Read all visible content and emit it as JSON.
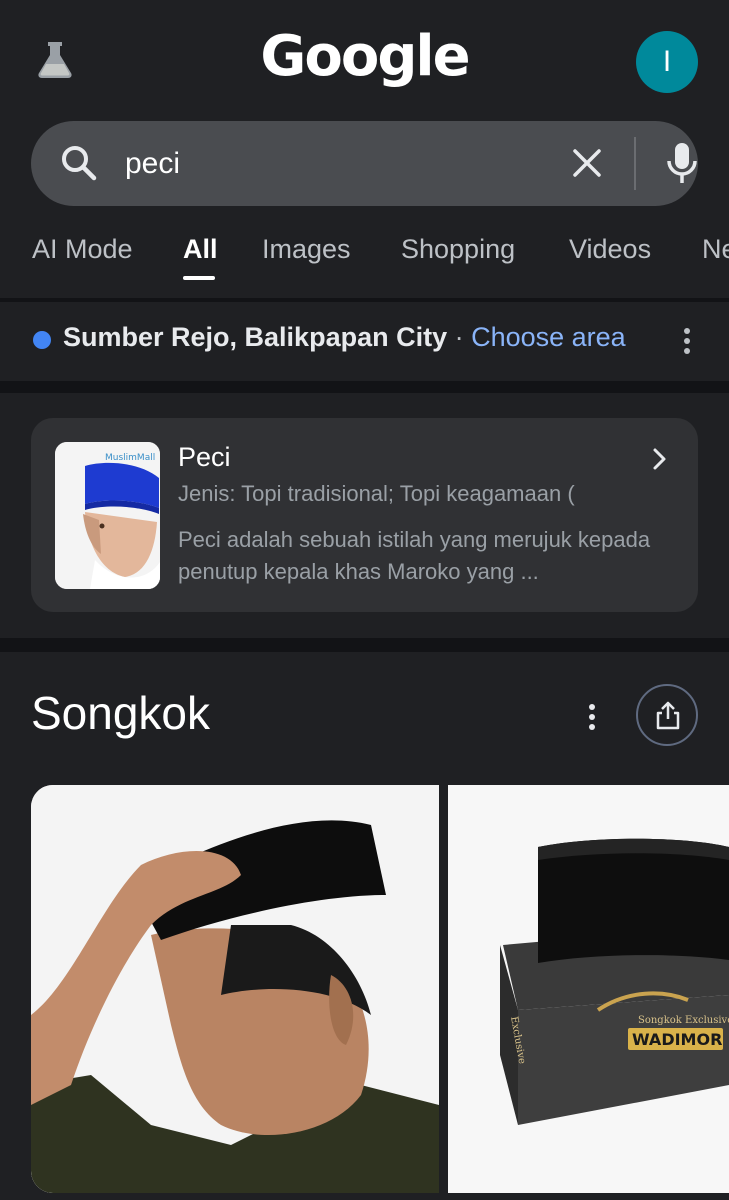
{
  "header": {
    "logo": "Google",
    "avatar_initial": "I",
    "labs_icon": "flask-icon"
  },
  "search": {
    "query": "peci",
    "icons": [
      "search-icon",
      "clear-icon",
      "mic-icon"
    ]
  },
  "tabs": [
    {
      "label": "AI Mode",
      "active": false
    },
    {
      "label": "All",
      "active": true
    },
    {
      "label": "Images",
      "active": false
    },
    {
      "label": "Shopping",
      "active": false
    },
    {
      "label": "Videos",
      "active": false
    },
    {
      "label": "News",
      "active": false
    }
  ],
  "location": {
    "place": "Sumber Rejo, Balikpapan City",
    "separator": " · ",
    "link": "Choose area"
  },
  "knowledge": {
    "title": "Peci",
    "type": "Jenis: Topi tradisional; Topi keagamaan (",
    "description": "Peci adalah sebuah istilah yang merujuk kepada penutup kepala khas Maroko yang ...",
    "thumb_watermark": "MuslimMall"
  },
  "section": {
    "title": "Songkok"
  },
  "images": [
    {
      "alt": "man-wearing-black-songkok"
    },
    {
      "alt": "songkok-box",
      "box_label": "Songkok Exclusive",
      "brand": "WADIMOR",
      "side_text": "Exclusive"
    }
  ],
  "colors": {
    "background": "#1f2023",
    "surface": "#303134",
    "search_bg": "#4a4c50",
    "link": "#8ab4f8",
    "avatar": "#00899b",
    "location_dot": "#4285f4"
  }
}
